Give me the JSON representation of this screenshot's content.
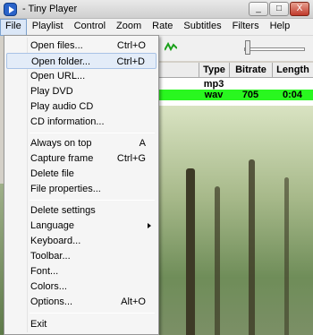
{
  "window": {
    "title": "- Tiny Player",
    "buttons": [
      "_",
      "□",
      "X"
    ]
  },
  "menubar": [
    "File",
    "Playlist",
    "Control",
    "Zoom",
    "Rate",
    "Subtitles",
    "Filters",
    "Help"
  ],
  "playlist": {
    "columns": [
      "Type",
      "Bitrate",
      "Length"
    ],
    "rows": [
      {
        "type": "mp3",
        "bitrate": "",
        "length": ""
      },
      {
        "type": "wav",
        "bitrate": "705",
        "length": "0:04"
      }
    ]
  },
  "file_menu": [
    {
      "label": "Open files...",
      "shortcut": "Ctrl+O"
    },
    {
      "label": "Open folder...",
      "shortcut": "Ctrl+D"
    },
    {
      "label": "Open URL...",
      "shortcut": ""
    },
    {
      "label": "Play DVD",
      "shortcut": ""
    },
    {
      "label": "Play audio CD",
      "shortcut": ""
    },
    {
      "label": "CD information...",
      "shortcut": ""
    },
    {
      "label": "Always on top",
      "shortcut": "A"
    },
    {
      "label": "Capture frame",
      "shortcut": "Ctrl+G"
    },
    {
      "label": "Delete file",
      "shortcut": ""
    },
    {
      "label": "File properties...",
      "shortcut": ""
    },
    {
      "label": "Delete settings",
      "shortcut": ""
    },
    {
      "label": "Language",
      "shortcut": ""
    },
    {
      "label": "Keyboard...",
      "shortcut": ""
    },
    {
      "label": "Toolbar...",
      "shortcut": ""
    },
    {
      "label": "Font...",
      "shortcut": ""
    },
    {
      "label": "Colors...",
      "shortcut": ""
    },
    {
      "label": "Options...",
      "shortcut": "Alt+O"
    },
    {
      "label": "Exit",
      "shortcut": ""
    }
  ],
  "colors": {
    "selected_row": "#29f71f",
    "menu_highlight": "#e3ecf8"
  }
}
